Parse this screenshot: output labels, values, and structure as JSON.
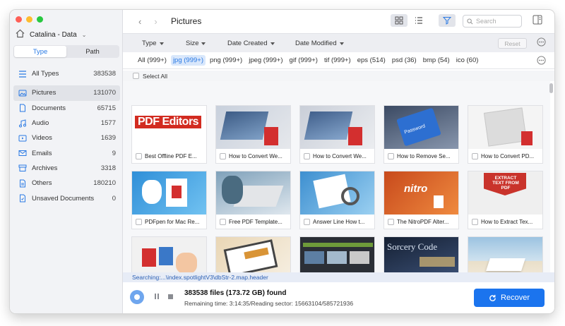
{
  "window": {
    "drive_name": "Catalina - Data",
    "tabs": [
      {
        "label": "Type",
        "active": true
      },
      {
        "label": "Path",
        "active": false
      }
    ]
  },
  "sidebar": {
    "items": [
      {
        "label": "All Types",
        "count": "383538",
        "icon": "all-types-icon"
      },
      {
        "label": "Pictures",
        "count": "131070",
        "icon": "picture-icon",
        "selected": true
      },
      {
        "label": "Documents",
        "count": "65715",
        "icon": "document-icon"
      },
      {
        "label": "Audio",
        "count": "1577",
        "icon": "audio-icon"
      },
      {
        "label": "Videos",
        "count": "1639",
        "icon": "video-icon"
      },
      {
        "label": "Emails",
        "count": "9",
        "icon": "email-icon"
      },
      {
        "label": "Archives",
        "count": "3318",
        "icon": "archive-icon"
      },
      {
        "label": "Others",
        "count": "180210",
        "icon": "others-icon"
      },
      {
        "label": "Unsaved Documents",
        "count": "0",
        "icon": "unsaved-icon"
      }
    ]
  },
  "toolbar": {
    "title": "Pictures",
    "search_placeholder": "Search"
  },
  "filters": {
    "dropdowns": [
      {
        "label": "Type"
      },
      {
        "label": "Size"
      },
      {
        "label": "Date Created"
      },
      {
        "label": "Date Modified"
      }
    ],
    "reset_label": "Reset"
  },
  "extensions": [
    {
      "label": "All (999+)",
      "active": false
    },
    {
      "label": "jpg (999+)",
      "active": true
    },
    {
      "label": "png (999+)",
      "active": false
    },
    {
      "label": "jpeg (999+)",
      "active": false
    },
    {
      "label": "gif (999+)",
      "active": false
    },
    {
      "label": "tif (999+)",
      "active": false
    },
    {
      "label": "eps (514)",
      "active": false
    },
    {
      "label": "psd (36)",
      "active": false
    },
    {
      "label": "bmp (54)",
      "active": false
    },
    {
      "label": "ico (60)",
      "active": false
    }
  ],
  "select_all_label": "Select All",
  "files": [
    {
      "name": "Best Offline PDF E...",
      "thumb_text": "PDF Editors",
      "color": "#d22b20"
    },
    {
      "name": "How to Convert We...",
      "thumb_text": "",
      "color": "#5a6a88"
    },
    {
      "name": "How to Convert We...",
      "thumb_text": "",
      "color": "#5f6f8a"
    },
    {
      "name": "How to Remove Se...",
      "thumb_text": "Password",
      "color": "#2d6fd1"
    },
    {
      "name": "How to Convert PD...",
      "thumb_text": "",
      "color": "#cfcfcf"
    },
    {
      "name": "PDFpen for Mac Re...",
      "thumb_text": "",
      "color": "#3aa6e6"
    },
    {
      "name": "Free PDF Template...",
      "thumb_text": "",
      "color": "#6c8fa8"
    },
    {
      "name": "Answer Line How t...",
      "thumb_text": "",
      "color": "#58a6d8"
    },
    {
      "name": "The NitroPDF Alter...",
      "thumb_text": "nitro",
      "color": "#e2672d"
    },
    {
      "name": "How to Extract Tex...",
      "thumb_text": "EXTRACT TEXT FROM PDF",
      "color": "#c9332b"
    },
    {
      "name": "",
      "thumb_text": "",
      "color": "#eaeaea"
    },
    {
      "name": "",
      "thumb_text": "",
      "color": "#d99436"
    },
    {
      "name": "",
      "thumb_text": "",
      "color": "#2b2f36"
    },
    {
      "name": "",
      "thumb_text": "Sorcery Code",
      "color": "#1d2b45"
    },
    {
      "name": "",
      "thumb_text": "",
      "color": "#8fb7d8"
    }
  ],
  "status": {
    "searching": "Searching:...\\index.spotlightV3\\dbStr-2.map.header",
    "found": "383538 files (173.72 GB) found",
    "remaining": "Remaining time: 3:14:35/Reading sector: 15663104/585721936",
    "recover_label": "Recover"
  }
}
